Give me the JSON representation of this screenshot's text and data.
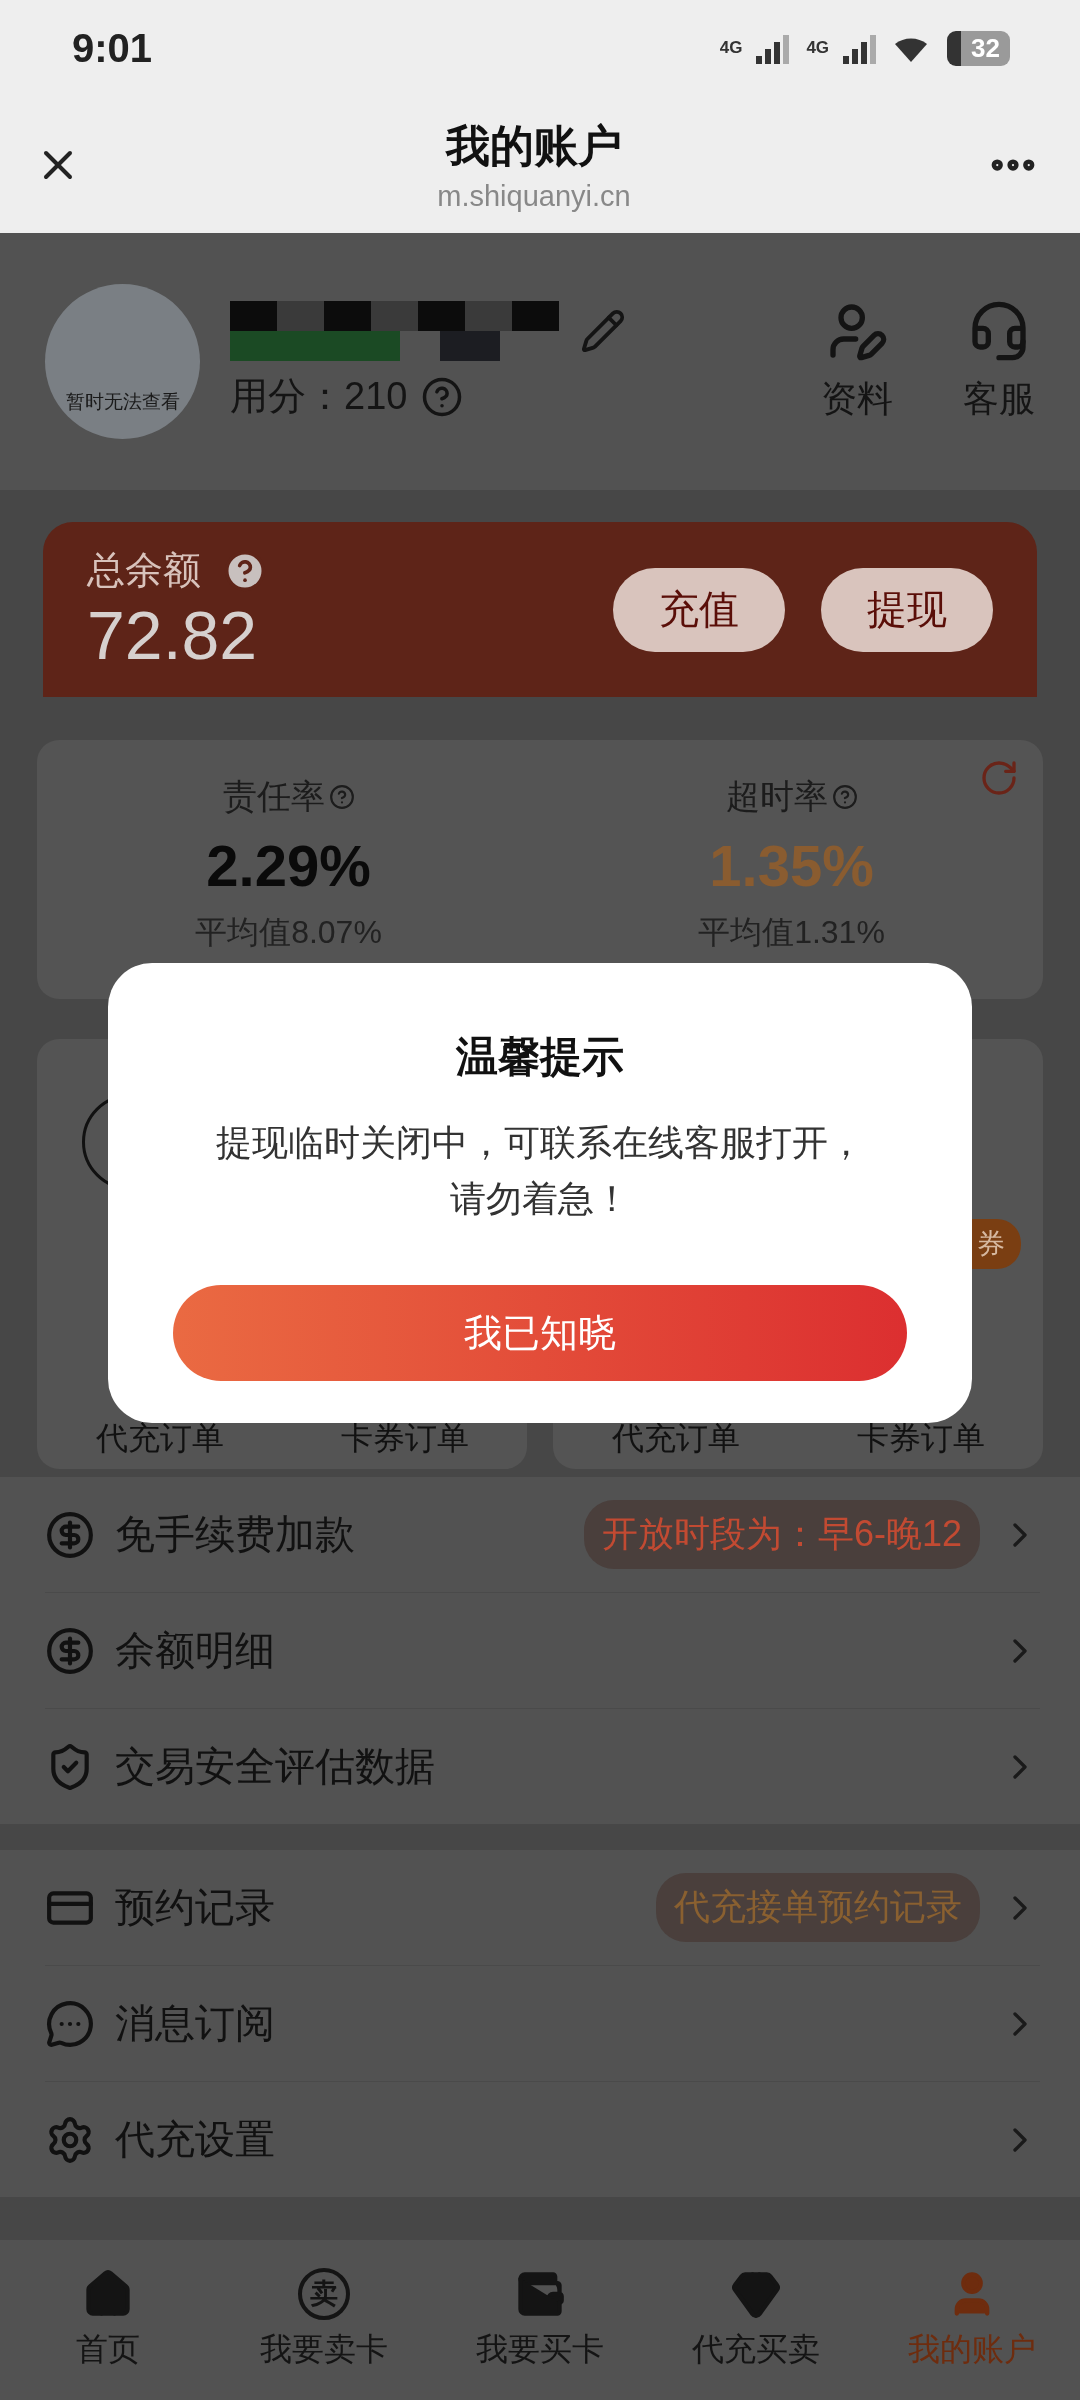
{
  "status_bar": {
    "time": "9:01",
    "network": [
      "4G",
      "4G"
    ],
    "battery": "32"
  },
  "header": {
    "title": "我的账户",
    "url": "m.shiquanyi.cn"
  },
  "profile": {
    "avatar_text": "暂时无法查看",
    "credit": "用分：210",
    "actions": [
      {
        "label": "资料"
      },
      {
        "label": "客服"
      }
    ]
  },
  "balance": {
    "label": "总余额",
    "amount": "72.82",
    "buttons": [
      "充值",
      "提现"
    ]
  },
  "stats": [
    {
      "title": "责任率",
      "value": "2.29%",
      "color": "#0a0a0a",
      "average": "平均值8.07%"
    },
    {
      "title": "超时率",
      "value": "1.35%",
      "color": "#8a5c30",
      "average": "平均值1.31%"
    }
  ],
  "order_cards": [
    {
      "labels": [
        "代充订单",
        "卡券订单"
      ]
    },
    {
      "badge": "券",
      "labels": [
        "代充订单",
        "卡券订单"
      ]
    }
  ],
  "menu_groups": [
    [
      {
        "label": "免手续费加款",
        "tag": {
          "text": "开放时段为：早6-晚12",
          "color": "#c24a32"
        }
      },
      {
        "label": "余额明细"
      },
      {
        "label": "交易安全评估数据"
      }
    ],
    [
      {
        "label": "预约记录",
        "tag": {
          "text": "代充接单预约记录",
          "color": "#8a6030"
        }
      },
      {
        "label": "消息订阅"
      },
      {
        "label": "代充设置"
      }
    ]
  ],
  "bottom_nav": [
    {
      "label": "首页",
      "selected": false
    },
    {
      "label": "我要卖卡",
      "icon_text": "卖",
      "selected": false
    },
    {
      "label": "我要买卡",
      "selected": false
    },
    {
      "label": "代充买卖",
      "selected": false
    },
    {
      "label": "我的账户",
      "selected": true
    }
  ],
  "dialog": {
    "title": "温馨提示",
    "message": "提现临时关闭中，可联系在线客服打开，请勿着急！",
    "button": "我已知晓"
  }
}
